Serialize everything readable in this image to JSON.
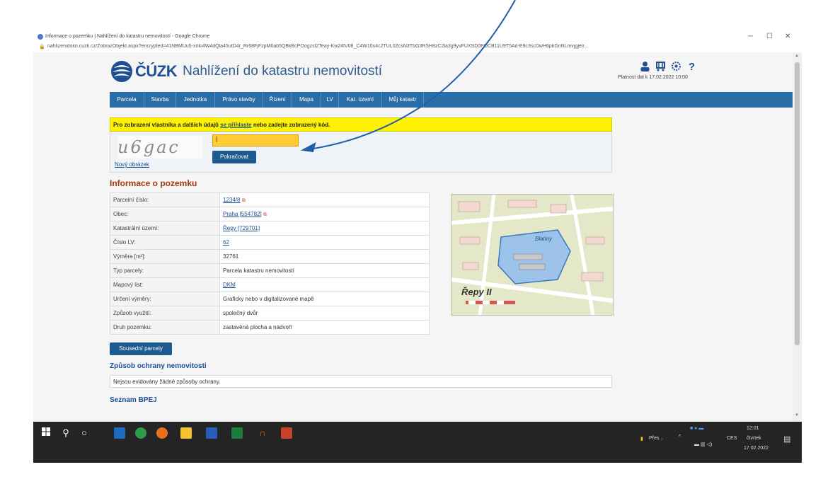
{
  "browser": {
    "tab_title": "Informace o pozemku | Nahlížení do katastru nemovitostí - Google Chrome",
    "url": "nahlizenidokn.cuzk.cz/ZobrazObjekt.aspx?encrypted=41NBMUu5-xrIki4W4dQla45utD4r_Rr68FjFzpM6ab5QBkBcPOogzst2Teay-Kw24fV08_C4W10x4c2TUL0ZcsN3TbG3RSH8zC2la3g9yvFUXSD0FOCB11U9T5Ad-E9c3scDwH6pkGnNLmvjgjelr...",
    "minimize": "─",
    "maximize": "☐",
    "close": "✕"
  },
  "header": {
    "brand": "ČÚZK",
    "title": "Nahlížení do katastru nemovitostí",
    "validity": "Platnost dat k 17.02.2022 10:00",
    "icons": [
      "user-icon",
      "cart-icon",
      "gear-icon",
      "help-icon"
    ]
  },
  "nav": {
    "items": [
      {
        "label": "Parcela"
      },
      {
        "label": "Stavba"
      },
      {
        "label": "Jednotka"
      },
      {
        "label": "Právo stavby"
      },
      {
        "label": "Řízení"
      },
      {
        "label": "Mapa"
      },
      {
        "label": "LV"
      },
      {
        "label": "Kat. území"
      },
      {
        "label": "Můj katastr"
      }
    ]
  },
  "login_notice": {
    "prefix": "Pro zobrazení vlastníka a dalších údajů ",
    "link": "se přihlaste",
    "suffix": " nebo zadejte zobrazený kód."
  },
  "captcha": {
    "code": "u6gac",
    "new_image": "Nový obrázek",
    "input_value": "|",
    "submit": "Pokračovat"
  },
  "parcel": {
    "heading": "Informace o pozemku",
    "rows": [
      {
        "label": "Parcelní číslo:",
        "value": "1234/8",
        "link": true
      },
      {
        "label": "Obec:",
        "value": "Praha [554782]",
        "link": true
      },
      {
        "label": "Katastrální území:",
        "value": "Řepy [729701]",
        "link": true
      },
      {
        "label": "Číslo LV:",
        "value": "62",
        "link": true
      },
      {
        "label": "Výměra [m²]:",
        "value": "32761",
        "link": false
      },
      {
        "label": "Typ parcely:",
        "value": "Parcela katastru nemovitostí",
        "link": false
      },
      {
        "label": "Mapový list:",
        "value": "DKM",
        "link": true
      },
      {
        "label": "Určení výměry:",
        "value": "Graficky nebo v digitalizované mapě",
        "link": false
      },
      {
        "label": "Způsob využití:",
        "value": "společný dvůr",
        "link": false
      },
      {
        "label": "Druh pozemku:",
        "value": "zastavěná plocha a nádvoří",
        "link": false
      }
    ],
    "neighbors_button": "Sousední parcely"
  },
  "map": {
    "label_area": "Řepy II",
    "label_pond": "Blatiny"
  },
  "protection": {
    "heading": "Způsob ochrany nemovitosti",
    "text": "Nejsou evidovány žádné způsoby ochrany."
  },
  "bpej": {
    "heading": "Seznam BPEJ"
  },
  "taskbar": {
    "tray_text": "Přes...",
    "lang": "CES",
    "time": "12:01",
    "day": "čtvrtek",
    "date": "17.02.2022"
  },
  "colors": {
    "nav": "#2a6ea8",
    "warning": "#fff200",
    "input": "#ffcc33",
    "arrow": "#1f5fa8"
  }
}
